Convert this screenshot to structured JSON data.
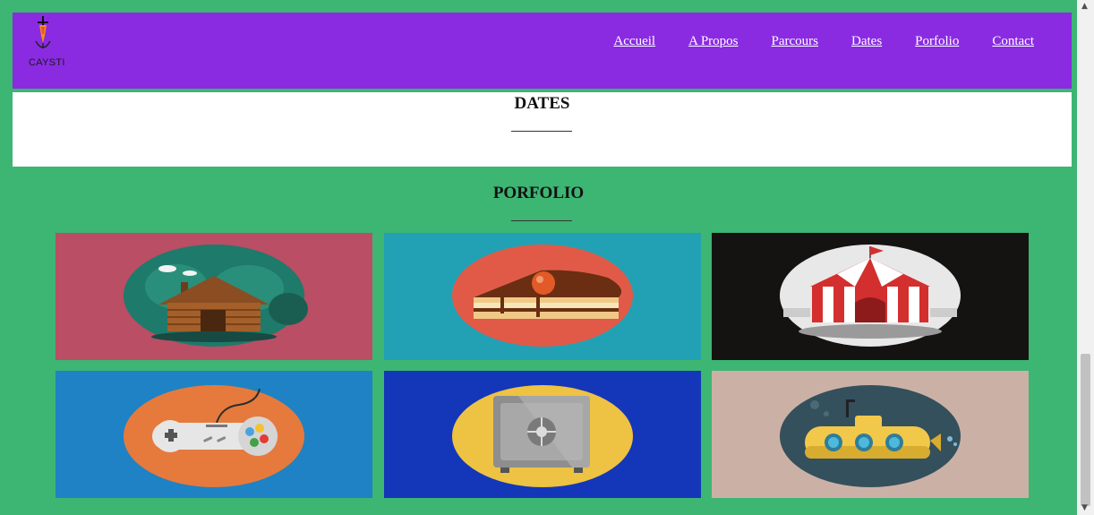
{
  "brand": {
    "logo_text": "CAYSTI"
  },
  "nav": {
    "items": [
      {
        "label": "Accueil"
      },
      {
        "label": "A Propos"
      },
      {
        "label": "Parcours"
      },
      {
        "label": "Dates"
      },
      {
        "label": "Porfolio"
      },
      {
        "label": "Contact"
      }
    ]
  },
  "sections": {
    "dates_title": "DATES",
    "portfolio_title": "PORFOLIO"
  },
  "portfolio": {
    "items": [
      {
        "icon": "log-cabin-icon",
        "bg": "#b94e64",
        "oval": "#1e7a6a"
      },
      {
        "icon": "cake-slice-icon",
        "bg": "#22a1b4",
        "oval": "#e15a48"
      },
      {
        "icon": "circus-tent-icon",
        "bg": "#151212",
        "oval": "#e8e8e8"
      },
      {
        "icon": "game-controller-icon",
        "bg": "#1f82c4",
        "oval": "#e67a3c"
      },
      {
        "icon": "safe-icon",
        "bg": "#1337b8",
        "oval": "#eec242"
      },
      {
        "icon": "submarine-icon",
        "bg": "#cbb1a5",
        "oval": "#34505c"
      }
    ]
  },
  "colors": {
    "page_bg": "#3db573",
    "nav_bg": "#8a2be2",
    "nav_text": "#ffffff"
  }
}
